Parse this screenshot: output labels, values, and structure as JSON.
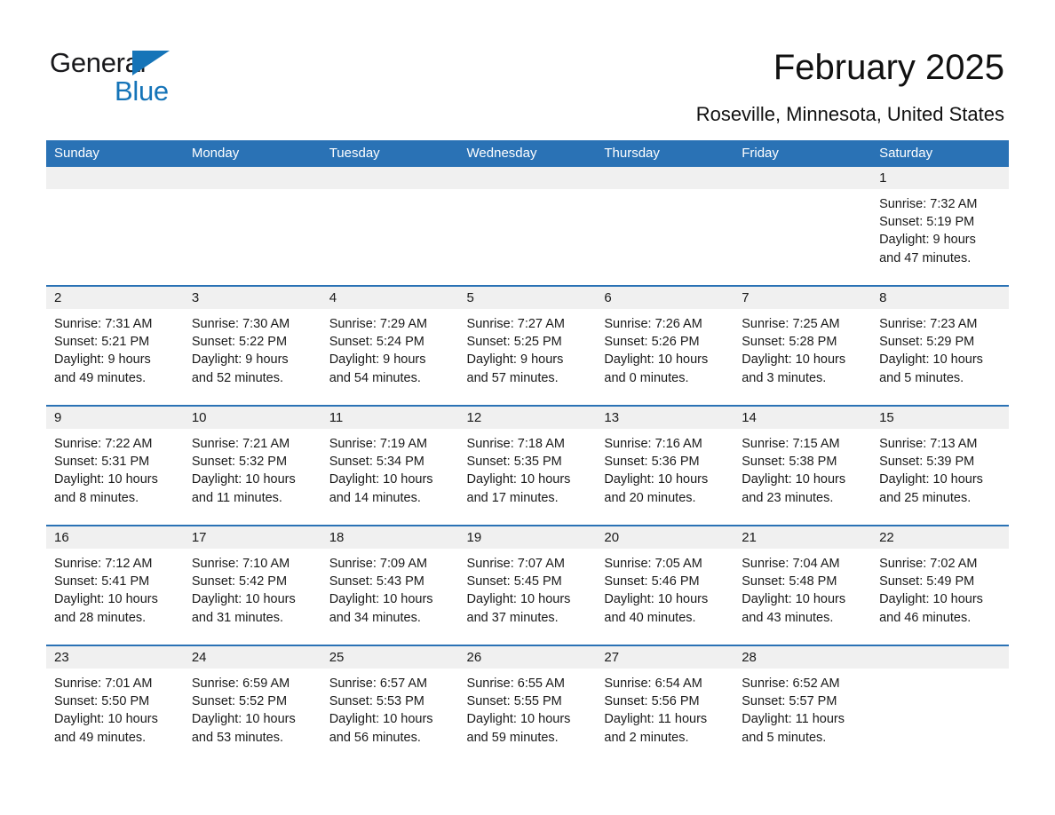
{
  "brand": {
    "name_part1": "General",
    "name_part2": "Blue",
    "accent_color": "#1574b8"
  },
  "header": {
    "title": "February 2025",
    "subtitle": "Roseville, Minnesota, United States"
  },
  "theme": {
    "header_blue": "#2a72b5",
    "daynum_band": "#f0f0f0",
    "page_background": "#ffffff",
    "text_color": "#1a1a1a"
  },
  "calendar": {
    "weekday_headers": [
      "Sunday",
      "Monday",
      "Tuesday",
      "Wednesday",
      "Thursday",
      "Friday",
      "Saturday"
    ],
    "weeks": [
      [
        {
          "day": "",
          "blank": true
        },
        {
          "day": "",
          "blank": true
        },
        {
          "day": "",
          "blank": true
        },
        {
          "day": "",
          "blank": true
        },
        {
          "day": "",
          "blank": true
        },
        {
          "day": "",
          "blank": true
        },
        {
          "day": "1",
          "sunrise": "Sunrise: 7:32 AM",
          "sunset": "Sunset: 5:19 PM",
          "daylight": "Daylight: 9 hours and 47 minutes."
        }
      ],
      [
        {
          "day": "2",
          "sunrise": "Sunrise: 7:31 AM",
          "sunset": "Sunset: 5:21 PM",
          "daylight": "Daylight: 9 hours and 49 minutes."
        },
        {
          "day": "3",
          "sunrise": "Sunrise: 7:30 AM",
          "sunset": "Sunset: 5:22 PM",
          "daylight": "Daylight: 9 hours and 52 minutes."
        },
        {
          "day": "4",
          "sunrise": "Sunrise: 7:29 AM",
          "sunset": "Sunset: 5:24 PM",
          "daylight": "Daylight: 9 hours and 54 minutes."
        },
        {
          "day": "5",
          "sunrise": "Sunrise: 7:27 AM",
          "sunset": "Sunset: 5:25 PM",
          "daylight": "Daylight: 9 hours and 57 minutes."
        },
        {
          "day": "6",
          "sunrise": "Sunrise: 7:26 AM",
          "sunset": "Sunset: 5:26 PM",
          "daylight": "Daylight: 10 hours and 0 minutes."
        },
        {
          "day": "7",
          "sunrise": "Sunrise: 7:25 AM",
          "sunset": "Sunset: 5:28 PM",
          "daylight": "Daylight: 10 hours and 3 minutes."
        },
        {
          "day": "8",
          "sunrise": "Sunrise: 7:23 AM",
          "sunset": "Sunset: 5:29 PM",
          "daylight": "Daylight: 10 hours and 5 minutes."
        }
      ],
      [
        {
          "day": "9",
          "sunrise": "Sunrise: 7:22 AM",
          "sunset": "Sunset: 5:31 PM",
          "daylight": "Daylight: 10 hours and 8 minutes."
        },
        {
          "day": "10",
          "sunrise": "Sunrise: 7:21 AM",
          "sunset": "Sunset: 5:32 PM",
          "daylight": "Daylight: 10 hours and 11 minutes."
        },
        {
          "day": "11",
          "sunrise": "Sunrise: 7:19 AM",
          "sunset": "Sunset: 5:34 PM",
          "daylight": "Daylight: 10 hours and 14 minutes."
        },
        {
          "day": "12",
          "sunrise": "Sunrise: 7:18 AM",
          "sunset": "Sunset: 5:35 PM",
          "daylight": "Daylight: 10 hours and 17 minutes."
        },
        {
          "day": "13",
          "sunrise": "Sunrise: 7:16 AM",
          "sunset": "Sunset: 5:36 PM",
          "daylight": "Daylight: 10 hours and 20 minutes."
        },
        {
          "day": "14",
          "sunrise": "Sunrise: 7:15 AM",
          "sunset": "Sunset: 5:38 PM",
          "daylight": "Daylight: 10 hours and 23 minutes."
        },
        {
          "day": "15",
          "sunrise": "Sunrise: 7:13 AM",
          "sunset": "Sunset: 5:39 PM",
          "daylight": "Daylight: 10 hours and 25 minutes."
        }
      ],
      [
        {
          "day": "16",
          "sunrise": "Sunrise: 7:12 AM",
          "sunset": "Sunset: 5:41 PM",
          "daylight": "Daylight: 10 hours and 28 minutes."
        },
        {
          "day": "17",
          "sunrise": "Sunrise: 7:10 AM",
          "sunset": "Sunset: 5:42 PM",
          "daylight": "Daylight: 10 hours and 31 minutes."
        },
        {
          "day": "18",
          "sunrise": "Sunrise: 7:09 AM",
          "sunset": "Sunset: 5:43 PM",
          "daylight": "Daylight: 10 hours and 34 minutes."
        },
        {
          "day": "19",
          "sunrise": "Sunrise: 7:07 AM",
          "sunset": "Sunset: 5:45 PM",
          "daylight": "Daylight: 10 hours and 37 minutes."
        },
        {
          "day": "20",
          "sunrise": "Sunrise: 7:05 AM",
          "sunset": "Sunset: 5:46 PM",
          "daylight": "Daylight: 10 hours and 40 minutes."
        },
        {
          "day": "21",
          "sunrise": "Sunrise: 7:04 AM",
          "sunset": "Sunset: 5:48 PM",
          "daylight": "Daylight: 10 hours and 43 minutes."
        },
        {
          "day": "22",
          "sunrise": "Sunrise: 7:02 AM",
          "sunset": "Sunset: 5:49 PM",
          "daylight": "Daylight: 10 hours and 46 minutes."
        }
      ],
      [
        {
          "day": "23",
          "sunrise": "Sunrise: 7:01 AM",
          "sunset": "Sunset: 5:50 PM",
          "daylight": "Daylight: 10 hours and 49 minutes."
        },
        {
          "day": "24",
          "sunrise": "Sunrise: 6:59 AM",
          "sunset": "Sunset: 5:52 PM",
          "daylight": "Daylight: 10 hours and 53 minutes."
        },
        {
          "day": "25",
          "sunrise": "Sunrise: 6:57 AM",
          "sunset": "Sunset: 5:53 PM",
          "daylight": "Daylight: 10 hours and 56 minutes."
        },
        {
          "day": "26",
          "sunrise": "Sunrise: 6:55 AM",
          "sunset": "Sunset: 5:55 PM",
          "daylight": "Daylight: 10 hours and 59 minutes."
        },
        {
          "day": "27",
          "sunrise": "Sunrise: 6:54 AM",
          "sunset": "Sunset: 5:56 PM",
          "daylight": "Daylight: 11 hours and 2 minutes."
        },
        {
          "day": "28",
          "sunrise": "Sunrise: 6:52 AM",
          "sunset": "Sunset: 5:57 PM",
          "daylight": "Daylight: 11 hours and 5 minutes."
        },
        {
          "day": "",
          "blank": true
        }
      ]
    ]
  }
}
